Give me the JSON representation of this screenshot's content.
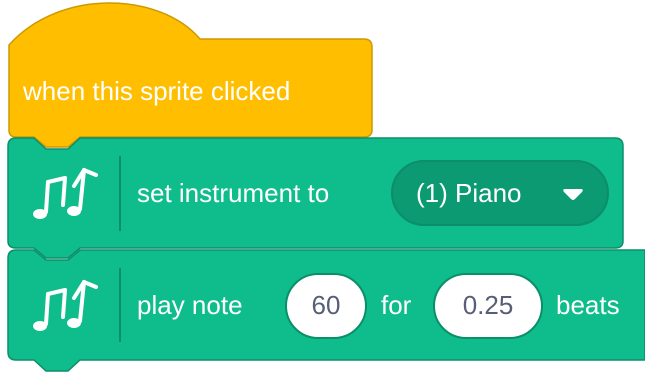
{
  "hat_block": {
    "label": "when this sprite clicked",
    "color": "#ffbf00",
    "border_color": "#cc9900"
  },
  "instrument_block": {
    "icon": "music-notes-icon",
    "label": "set instrument to",
    "dropdown_value": "(1) Piano",
    "dropdown_icon": "caret-down-icon",
    "color": "#0fbd8c",
    "border_color": "#0b8e69"
  },
  "play_note_block": {
    "icon": "music-notes-icon",
    "label_play": "play note",
    "note_value": "60",
    "label_for": "for",
    "beats_value": "0.25",
    "label_beats": "beats",
    "color": "#0fbd8c",
    "border_color": "#0b8e69"
  }
}
